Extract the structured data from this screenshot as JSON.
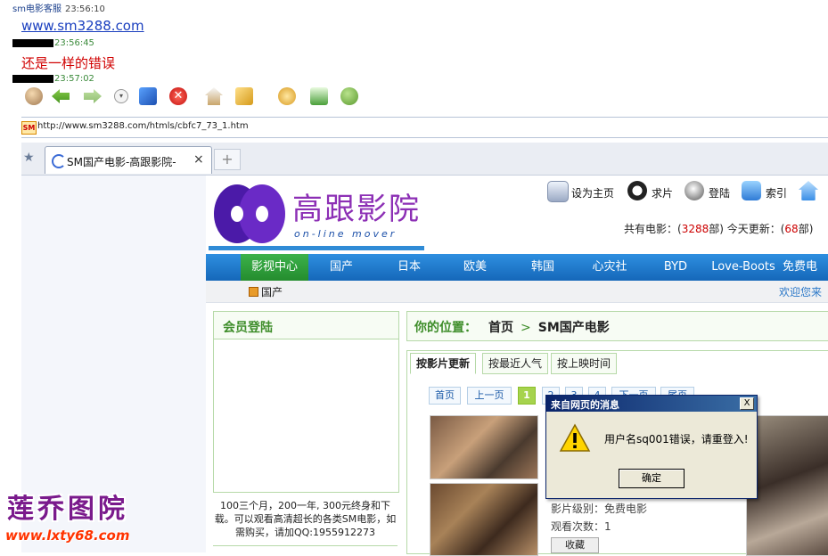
{
  "chat": {
    "sender": "sm电影客服",
    "time1": "23:56:10",
    "link": "www.sm3288.com",
    "time2": "23:56:45",
    "message": "还是一样的错误",
    "time3": "23:57:02"
  },
  "browser": {
    "favicon_label": "SM",
    "url": "http://www.sm3288.com/htmls/cbfc7_73_1.htm",
    "tab_title": "SM国产电影-高跟影院-",
    "tab_close": "×",
    "new_tab": "+",
    "toolbar_icons": [
      "user-icon",
      "back-icon",
      "forward-icon",
      "dropdown-icon",
      "refresh-icon",
      "stop-icon",
      "home-icon",
      "edit-icon",
      "history-icon",
      "screenshot-icon",
      "contacts-icon"
    ]
  },
  "site": {
    "logo_text": "高跟影院",
    "logo_sub": "on-line mover",
    "top_links": [
      "设为主页",
      "求片",
      "登陆",
      "索引"
    ],
    "stats": {
      "label1": "共有电影：(",
      "count": "3288",
      "label2": "部) 今天更新：(",
      "today": "68",
      "label3": "部)"
    },
    "nav": [
      "影视中心",
      "国产",
      "日本",
      "欧美",
      "韩国",
      "心灾社",
      "BYD",
      "Love-Boots",
      "免费电"
    ],
    "subnav_label": "国产",
    "welcome": "欢迎您来",
    "member_title": "会员登陆",
    "promo": "100三个月，200一年, 300元终身和下载。可以观看高清超长的各类SM电影，如需购买，请加QQ:1955912273",
    "location_label": "你的位置：",
    "crumb_home": "首页",
    "crumb_sep": ">",
    "crumb_current": "SM国产电影",
    "sort_tabs": [
      "按影片更新",
      "按最近人气",
      "按上映时间"
    ],
    "pager": [
      "首页",
      "上一页",
      "1",
      "2",
      "3",
      "4",
      "下一页",
      "尾页"
    ],
    "movie_level": "影片级别：免费电影",
    "views": "观看次数：1",
    "collect": "收藏"
  },
  "dialog": {
    "title": "来自网页的消息",
    "close": "X",
    "message": "用户名sq001错误，请重登入!",
    "ok": "确定"
  },
  "watermark": {
    "text": "莲乔图院",
    "url": "www.lxty68.com"
  }
}
